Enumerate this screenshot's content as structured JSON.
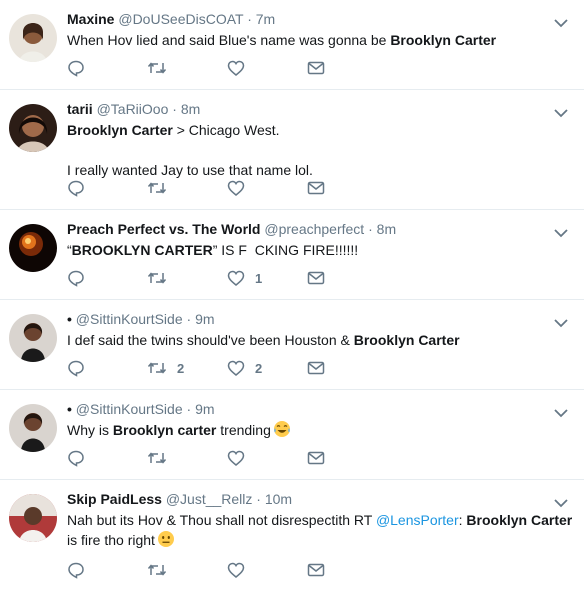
{
  "tweets": [
    {
      "name": "Maxine",
      "handle": "@DoUSeeDisCOAT",
      "time": "7m",
      "lines": [
        {
          "pre": "When Hov lied and said Blue's name was gonna be ",
          "bold": "Brooklyn Carter",
          "post": ""
        }
      ],
      "replies": "",
      "retweets": "",
      "likes": ""
    },
    {
      "name": "tarii",
      "handle": "@TaRiiOoo",
      "time": "8m",
      "line1_bold": "Brooklyn Carter",
      "line1_post": " > Chicago West.",
      "line2": "I really wanted Jay to use that name lol.",
      "replies": "",
      "retweets": "",
      "likes": ""
    },
    {
      "name": "Preach Perfect vs. The World",
      "handle": "@preachperfect",
      "time": "8m",
      "pre": "“",
      "bold": "BROOKLYN CARTER",
      "post": "” IS F  CKING FIRE!!!!!!",
      "replies": "",
      "retweets": "",
      "likes": "1"
    },
    {
      "name": "•",
      "handle": "@SittinKourtSide",
      "time": "9m",
      "pre": "I def said the twins should've been Houston & ",
      "bold": "Brooklyn Carter",
      "post": "",
      "replies": "",
      "retweets": "2",
      "likes": "2"
    },
    {
      "name": "•",
      "handle": "@SittinKourtSide",
      "time": "9m",
      "pre": "Why is ",
      "bold": "Brooklyn carter",
      "post": " trending",
      "emoji": "tears-of-joy-emoji",
      "replies": "",
      "retweets": "",
      "likes": ""
    },
    {
      "name": "Skip PaidLess",
      "handle": "@Just__Rellz",
      "time": "10m",
      "pre": "Nah but its Hov & Thou shall not disrespectith RT ",
      "mention": "@LensPorter",
      "mid": ": ",
      "bold": "Brooklyn Carter",
      "line2": "is fire tho right",
      "emoji": "neutral-face-emoji",
      "replies": "",
      "retweets": "",
      "likes": ""
    }
  ],
  "dot": "·",
  "icons": [
    "reply-icon",
    "retweet-icon",
    "like-icon",
    "direct-message-icon",
    "caret-down-icon"
  ],
  "colors": {
    "text": "#14171a",
    "muted": "#657786",
    "link": "#1b95e0",
    "divider": "#e6ecf0"
  }
}
